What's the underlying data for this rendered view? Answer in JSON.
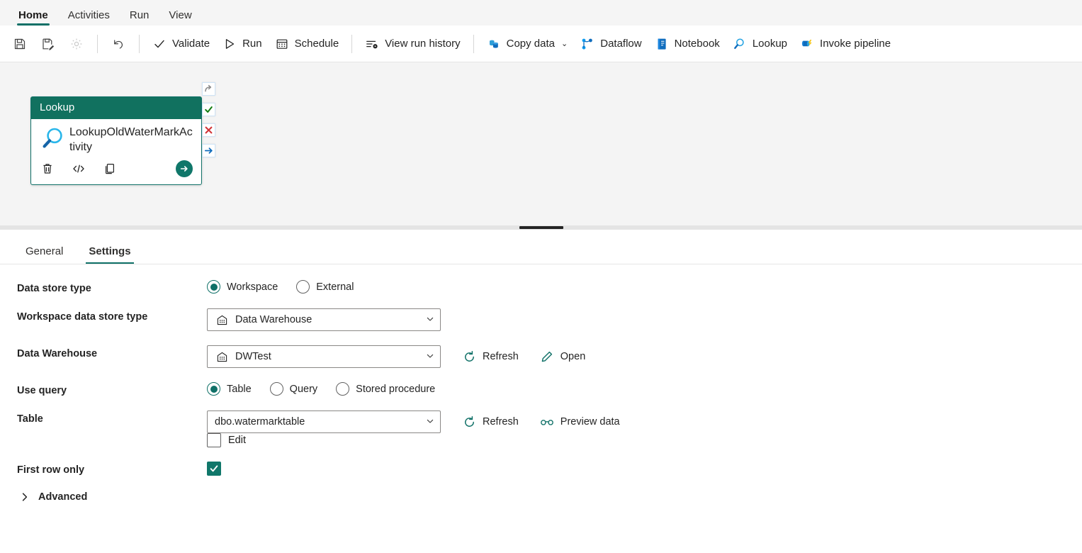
{
  "ribbon": {
    "tabs": [
      {
        "label": "Home",
        "active": true
      },
      {
        "label": "Activities",
        "active": false
      },
      {
        "label": "Run",
        "active": false
      },
      {
        "label": "View",
        "active": false
      }
    ]
  },
  "toolbar": {
    "save_icon": "save-icon",
    "save_as_icon": "save-as-icon",
    "settings_icon": "gear-icon",
    "undo_icon": "undo-icon",
    "validate_label": "Validate",
    "run_label": "Run",
    "schedule_label": "Schedule",
    "view_run_history_label": "View run history",
    "copy_data_label": "Copy data",
    "copy_data_chevron": "⌄",
    "dataflow_label": "Dataflow",
    "notebook_label": "Notebook",
    "lookup_label": "Lookup",
    "invoke_pipeline_label": "Invoke pipeline"
  },
  "canvas": {
    "activity": {
      "type_label": "Lookup",
      "name": "LookupOldWaterMarkActivity",
      "icon": "lookup-magnifier-icon",
      "actions": {
        "delete": "delete-icon",
        "code": "code-view-icon",
        "duplicate": "duplicate-icon",
        "run_from": "run-from-activity-icon"
      },
      "handles": [
        {
          "name": "skip-handle",
          "glyph": "↷"
        },
        {
          "name": "success-handle",
          "glyph": "✓"
        },
        {
          "name": "failure-handle",
          "glyph": "✕"
        },
        {
          "name": "completion-handle",
          "glyph": "→"
        }
      ]
    }
  },
  "panel": {
    "tabs": [
      {
        "label": "General",
        "active": false
      },
      {
        "label": "Settings",
        "active": true
      }
    ],
    "fields": {
      "data_store_type": {
        "label": "Data store type",
        "options": [
          {
            "label": "Workspace",
            "checked": true
          },
          {
            "label": "External",
            "checked": false
          }
        ]
      },
      "workspace_data_store_type": {
        "label": "Workspace data store type",
        "value": "Data Warehouse",
        "icon": "warehouse-icon"
      },
      "data_warehouse": {
        "label": "Data Warehouse",
        "value": "DWTest",
        "icon": "warehouse-icon",
        "refresh_label": "Refresh",
        "open_label": "Open"
      },
      "use_query": {
        "label": "Use query",
        "options": [
          {
            "label": "Table",
            "checked": true
          },
          {
            "label": "Query",
            "checked": false
          },
          {
            "label": "Stored procedure",
            "checked": false
          }
        ]
      },
      "table": {
        "label": "Table",
        "value": "dbo.watermarktable",
        "refresh_label": "Refresh",
        "preview_label": "Preview data",
        "edit_label": "Edit",
        "edit_checked": false
      },
      "first_row_only": {
        "label": "First row only",
        "checked": true
      },
      "advanced": {
        "label": "Advanced",
        "expanded": false
      }
    }
  },
  "colors": {
    "accent_teal": "#0f7067",
    "card_header": "#11715f",
    "checkbox_fill": "#10776a",
    "brand_blue": "#0078d4",
    "success_green": "#107c10",
    "failure_red": "#d13438"
  }
}
